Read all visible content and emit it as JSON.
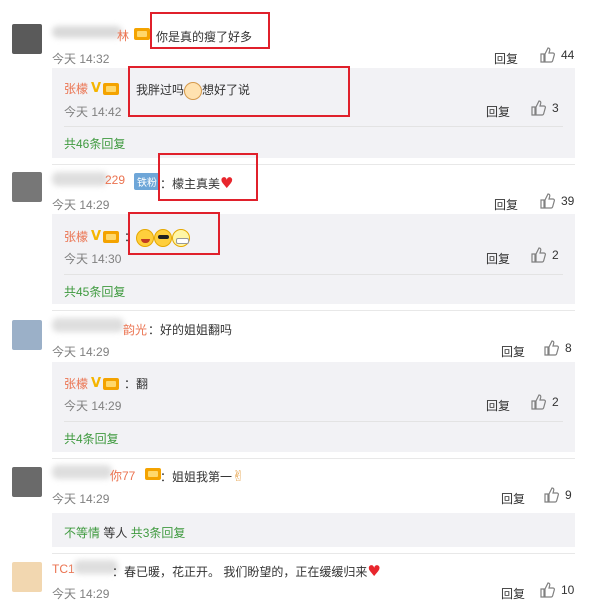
{
  "ui": {
    "reply": "回复",
    "time_prefix": "今天"
  },
  "comments": [
    {
      "name_tail": "林",
      "text": "你是真的瘦了好多",
      "time": "今天 14:32",
      "likes": "44",
      "sub": {
        "name": "张檬",
        "sep": "：",
        "text_a": "我胖过吗",
        "text_b": "想好了说",
        "time": "今天 14:42",
        "likes": "3"
      },
      "more": "共46条回复"
    },
    {
      "name_tail": "229",
      "badge": "铁粉",
      "sep": "：",
      "text": "檬主真美",
      "time": "今天 14:29",
      "likes": "39",
      "sub": {
        "name": "张檬",
        "sep": "：",
        "time": "今天 14:30",
        "likes": "2"
      },
      "more": "共45条回复"
    },
    {
      "name_tail": "韵光",
      "sep": "：",
      "text": "好的姐姐翻吗",
      "time": "今天 14:29",
      "likes": "8",
      "sub": {
        "name": "张檬",
        "sep": "：",
        "text": "翻",
        "time": "今天 14:29",
        "likes": "2"
      },
      "more": "共4条回复"
    },
    {
      "name_tail": "你77",
      "sep": "：",
      "text": "姐姐我第一",
      "time": "今天 14:29",
      "likes": "9",
      "sub_inline": {
        "name": "不等情",
        "mid": "等人",
        "more": "共3条回复"
      }
    },
    {
      "name_head": "TC1",
      "sep": "：",
      "text": "春已暖，花正开。 我们盼望的，正在缓缓归来",
      "time": "今天 14:29",
      "likes": "10"
    }
  ],
  "colors": {
    "name": "#eb7350",
    "link": "#3f9a3f",
    "highlight": "#e0202b"
  },
  "icons": {
    "like": "thumbs-up-icon",
    "heart": "heart-icon",
    "vip": "vip-badge-icon"
  }
}
